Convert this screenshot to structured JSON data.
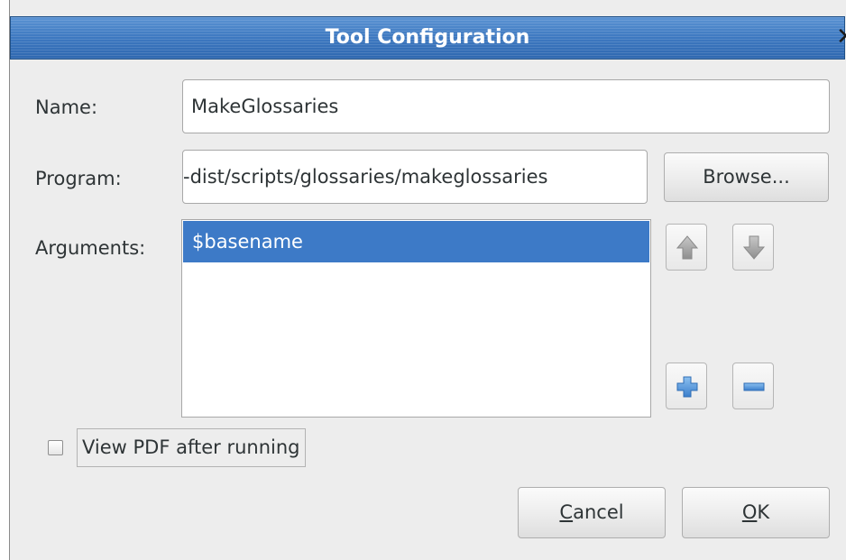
{
  "window": {
    "title": "Tool Configuration",
    "close_glyph": "✕"
  },
  "form": {
    "name_label": "Name:",
    "name_value": "MakeGlossaries",
    "program_label": "Program:",
    "program_value": "-dist/scripts/glossaries/makeglossaries",
    "browse_label": "Browse...",
    "arguments_label": "Arguments:",
    "arguments": [
      {
        "value": "$basename",
        "selected": true
      }
    ]
  },
  "argument_buttons": {
    "move_up_icon": "arrow-up-icon",
    "move_down_icon": "arrow-down-icon",
    "add_icon": "plus-icon",
    "remove_icon": "minus-icon"
  },
  "options": {
    "view_pdf_label": "View PDF after running",
    "view_pdf_checked": false
  },
  "actions": {
    "cancel_label": "Cancel",
    "ok_label": "OK"
  },
  "colors": {
    "titlebar": "#3d78c0",
    "selection": "#3d7ac7",
    "add_icon": "#4a8fd8",
    "disabled_arrow": "#a9a9a9"
  }
}
